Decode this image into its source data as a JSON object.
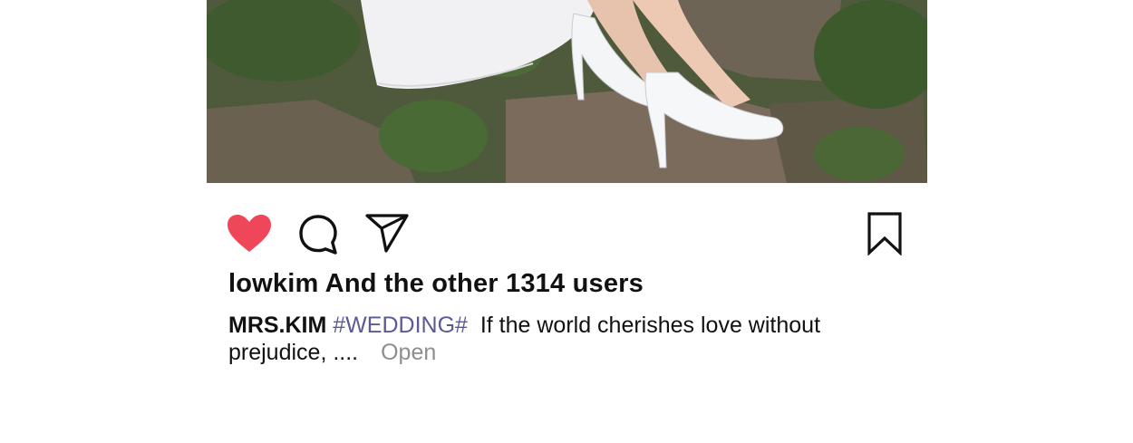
{
  "post": {
    "actions": {
      "like_icon": "heart-icon",
      "comment_icon": "comment-icon",
      "share_icon": "send-icon",
      "save_icon": "bookmark-icon",
      "like_color": "#f0465a"
    },
    "likes_text": "lowkim And the other 1314 users",
    "caption": {
      "username": "MRS.KIM",
      "hashtag": "#WEDDING#",
      "text_line1": "If the world cherishes love without",
      "text_line2": "prejudice, ....",
      "more_label": "Open"
    }
  }
}
